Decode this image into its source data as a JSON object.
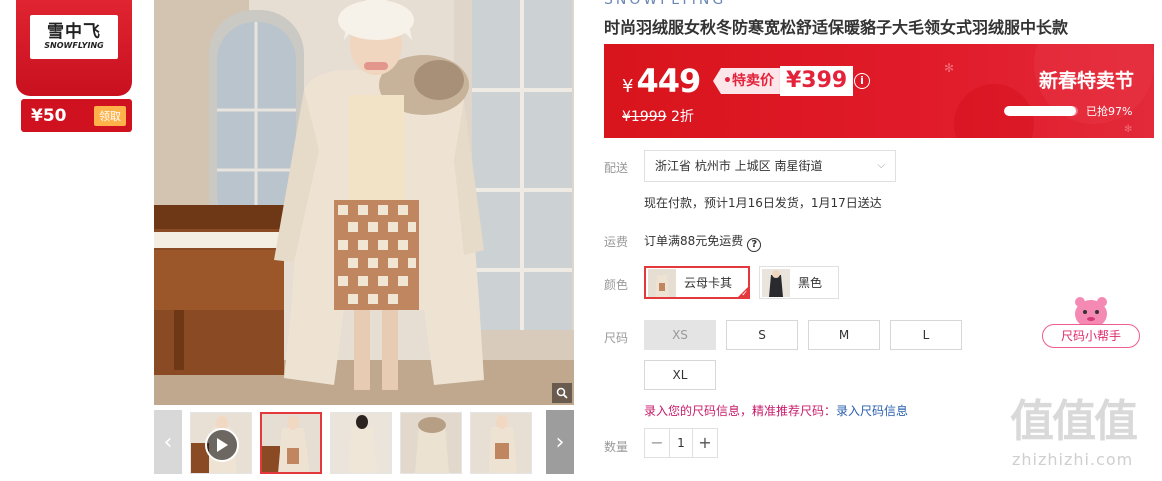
{
  "store": {
    "logo_cn": "雪中飞",
    "logo_en": "SNOWFLYING",
    "coupon_amount": "¥50",
    "coupon_button": "领取"
  },
  "gallery": {
    "thumb_prev_icon": "chevron-left-icon",
    "thumb_next_icon": "chevron-right-icon",
    "zoom_icon": "magnifier-icon",
    "play_icon": "play-icon",
    "thumb_count": 6,
    "active_thumb_index": 1
  },
  "product": {
    "top_cut_text": "SNOWFLYING",
    "title": "时尚羽绒服女秋冬防寒宽松舒适保暖貉子大毛领女式羽绒服中长款"
  },
  "price": {
    "currency": "¥",
    "current": "449",
    "special_label": "•特卖价",
    "special_price": "¥399",
    "original": "¥1999",
    "discount": "2折",
    "festival": "新春特卖节",
    "sold_text": "已抢97%",
    "sold_fraction": 0.97
  },
  "delivery": {
    "label": "配送",
    "address": "浙江省 杭州市 上城区 南星街道",
    "eta": "现在付款，预计1月16日发货，1月17日送达"
  },
  "shipping": {
    "label": "运费",
    "text": "订单满88元免运费"
  },
  "color": {
    "label": "颜色",
    "options": [
      {
        "name": "云母卡其",
        "selected": true
      },
      {
        "name": "黑色",
        "selected": false
      }
    ]
  },
  "size": {
    "label": "尺码",
    "options": [
      {
        "name": "XS",
        "disabled": true
      },
      {
        "name": "S",
        "disabled": false
      },
      {
        "name": "M",
        "disabled": false
      },
      {
        "name": "L",
        "disabled": false
      },
      {
        "name": "XL",
        "disabled": false
      }
    ],
    "helper": "尺码小帮手",
    "hint_prefix": "录入您的尺码信息，精准推荐尺码：",
    "hint_link": "录入尺码信息"
  },
  "quantity": {
    "label": "数量",
    "value": "1",
    "minus": "−",
    "plus": "+"
  },
  "watermark": {
    "logo": "值值值",
    "url": "zhizhizhi.com"
  },
  "colors": {
    "accent_red": "#e4393c",
    "banner_red": "#e11b2a",
    "link_blue": "#2a5fae",
    "pink": "#c81b6b"
  }
}
